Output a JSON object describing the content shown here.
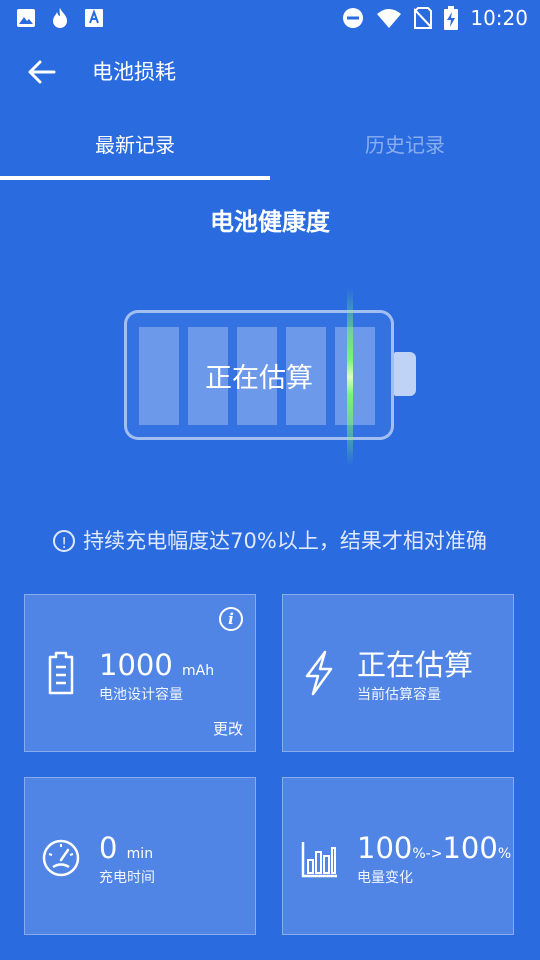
{
  "status_bar": {
    "time": "10:20",
    "left_icons": [
      "image-icon",
      "fire-icon",
      "font-app-icon"
    ],
    "right_icons": [
      "do-not-disturb-icon",
      "wifi-icon",
      "no-sim-icon",
      "battery-charging-icon"
    ]
  },
  "app_bar": {
    "title": "电池损耗",
    "back_icon": "arrow-left-icon"
  },
  "tabs": [
    {
      "label": "最新记录",
      "active": true
    },
    {
      "label": "历史记录",
      "active": false
    }
  ],
  "health": {
    "title": "电池健康度",
    "status": "正在估算"
  },
  "hint": "持续充电幅度达70%以上，结果才相对准确",
  "cards": {
    "design_capacity": {
      "value": "1000",
      "unit": "mAh",
      "label": "电池设计容量",
      "action": "更改",
      "icon": "battery-outline-icon"
    },
    "estimated_capacity": {
      "value": "正在估算",
      "label": "当前估算容量",
      "icon": "lightning-icon"
    },
    "charge_time": {
      "value": "0",
      "unit": "min",
      "label": "充电时间",
      "icon": "speedometer-icon"
    },
    "level_change": {
      "from": "100",
      "from_unit": "%->",
      "to": "100",
      "to_unit": "%",
      "label": "电量变化",
      "icon": "bar-chart-icon"
    }
  },
  "colors": {
    "background": "#2a6be0",
    "scan_line": "#78ff64"
  }
}
